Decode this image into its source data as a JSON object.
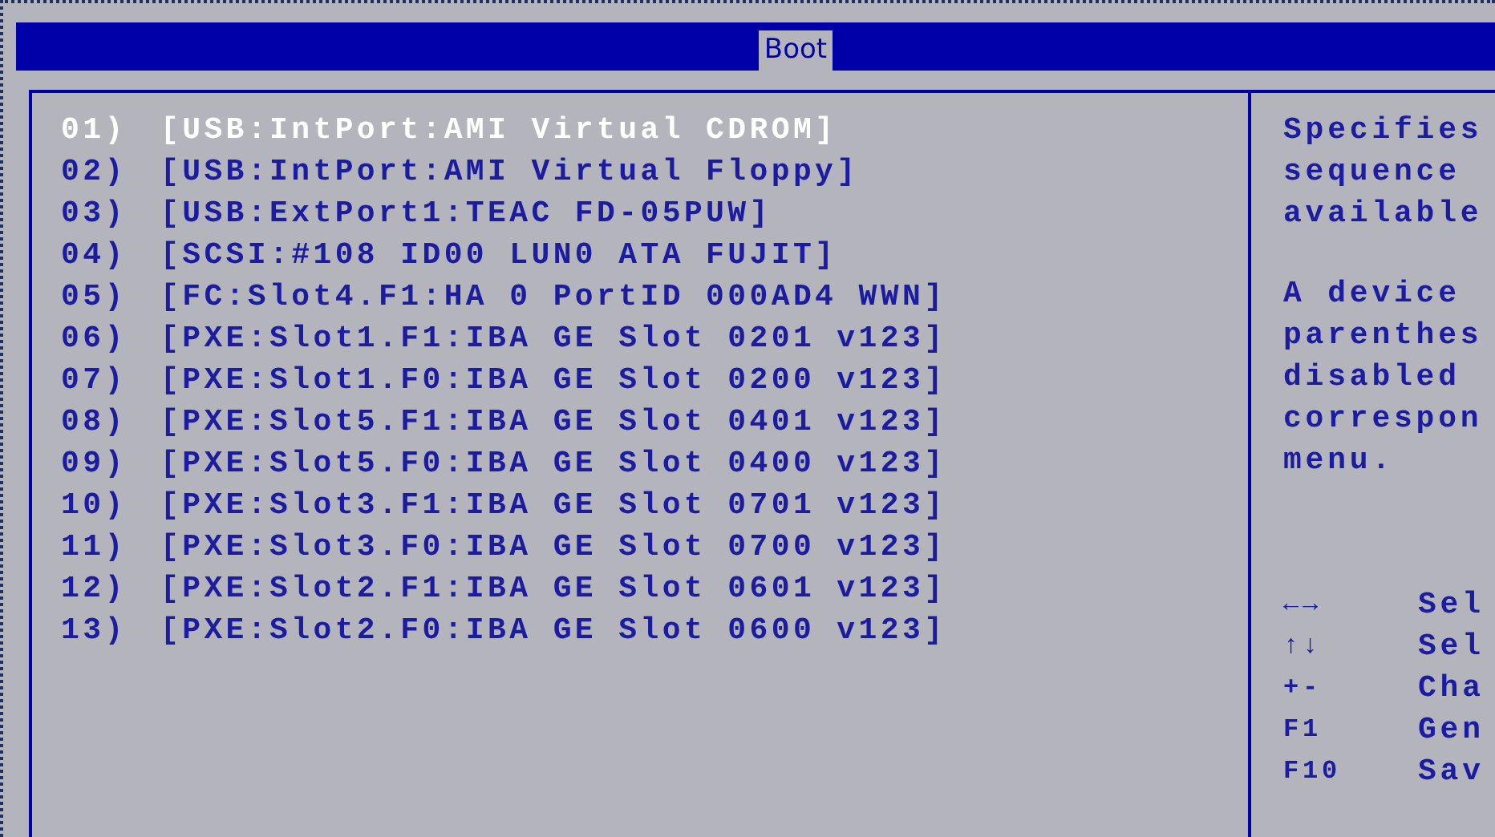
{
  "title_bar": {
    "tab": "Boot"
  },
  "boot_items": [
    {
      "number": "01)",
      "device": "[USB:IntPort:AMI Virtual CDROM]",
      "selected": true
    },
    {
      "number": "02)",
      "device": "[USB:IntPort:AMI Virtual Floppy]",
      "selected": false
    },
    {
      "number": "03)",
      "device": "[USB:ExtPort1:TEAC FD-05PUW]",
      "selected": false
    },
    {
      "number": "04)",
      "device": "[SCSI:#108 ID00 LUN0 ATA FUJIT]",
      "selected": false
    },
    {
      "number": "05)",
      "device": "[FC:Slot4.F1:HA 0 PortID 000AD4 WWN]",
      "selected": false
    },
    {
      "number": "06)",
      "device": "[PXE:Slot1.F1:IBA GE Slot 0201 v123]",
      "selected": false
    },
    {
      "number": "07)",
      "device": "[PXE:Slot1.F0:IBA GE Slot 0200 v123]",
      "selected": false
    },
    {
      "number": "08)",
      "device": "[PXE:Slot5.F1:IBA GE Slot 0401 v123]",
      "selected": false
    },
    {
      "number": "09)",
      "device": "[PXE:Slot5.F0:IBA GE Slot 0400 v123]",
      "selected": false
    },
    {
      "number": "10)",
      "device": "[PXE:Slot3.F1:IBA GE Slot 0701 v123]",
      "selected": false
    },
    {
      "number": "11)",
      "device": "[PXE:Slot3.F0:IBA GE Slot 0700 v123]",
      "selected": false
    },
    {
      "number": "12)",
      "device": "[PXE:Slot2.F1:IBA GE Slot 0601 v123]",
      "selected": false
    },
    {
      "number": "13)",
      "device": "[PXE:Slot2.F0:IBA GE Slot 0600 v123]",
      "selected": false
    }
  ],
  "help_panel": {
    "paragraphs": [
      [
        "Specifies",
        "sequence",
        "available"
      ],
      [
        "A device",
        "parenthes",
        "disabled",
        "correspon",
        "menu."
      ]
    ],
    "keys": [
      {
        "key": "←→",
        "action": "Sel"
      },
      {
        "key": "↑↓",
        "action": "Sel"
      },
      {
        "key": "+-",
        "action": "Cha"
      },
      {
        "key": "F1",
        "action": "Gen"
      },
      {
        "key": "F10",
        "action": "Sav"
      }
    ]
  }
}
